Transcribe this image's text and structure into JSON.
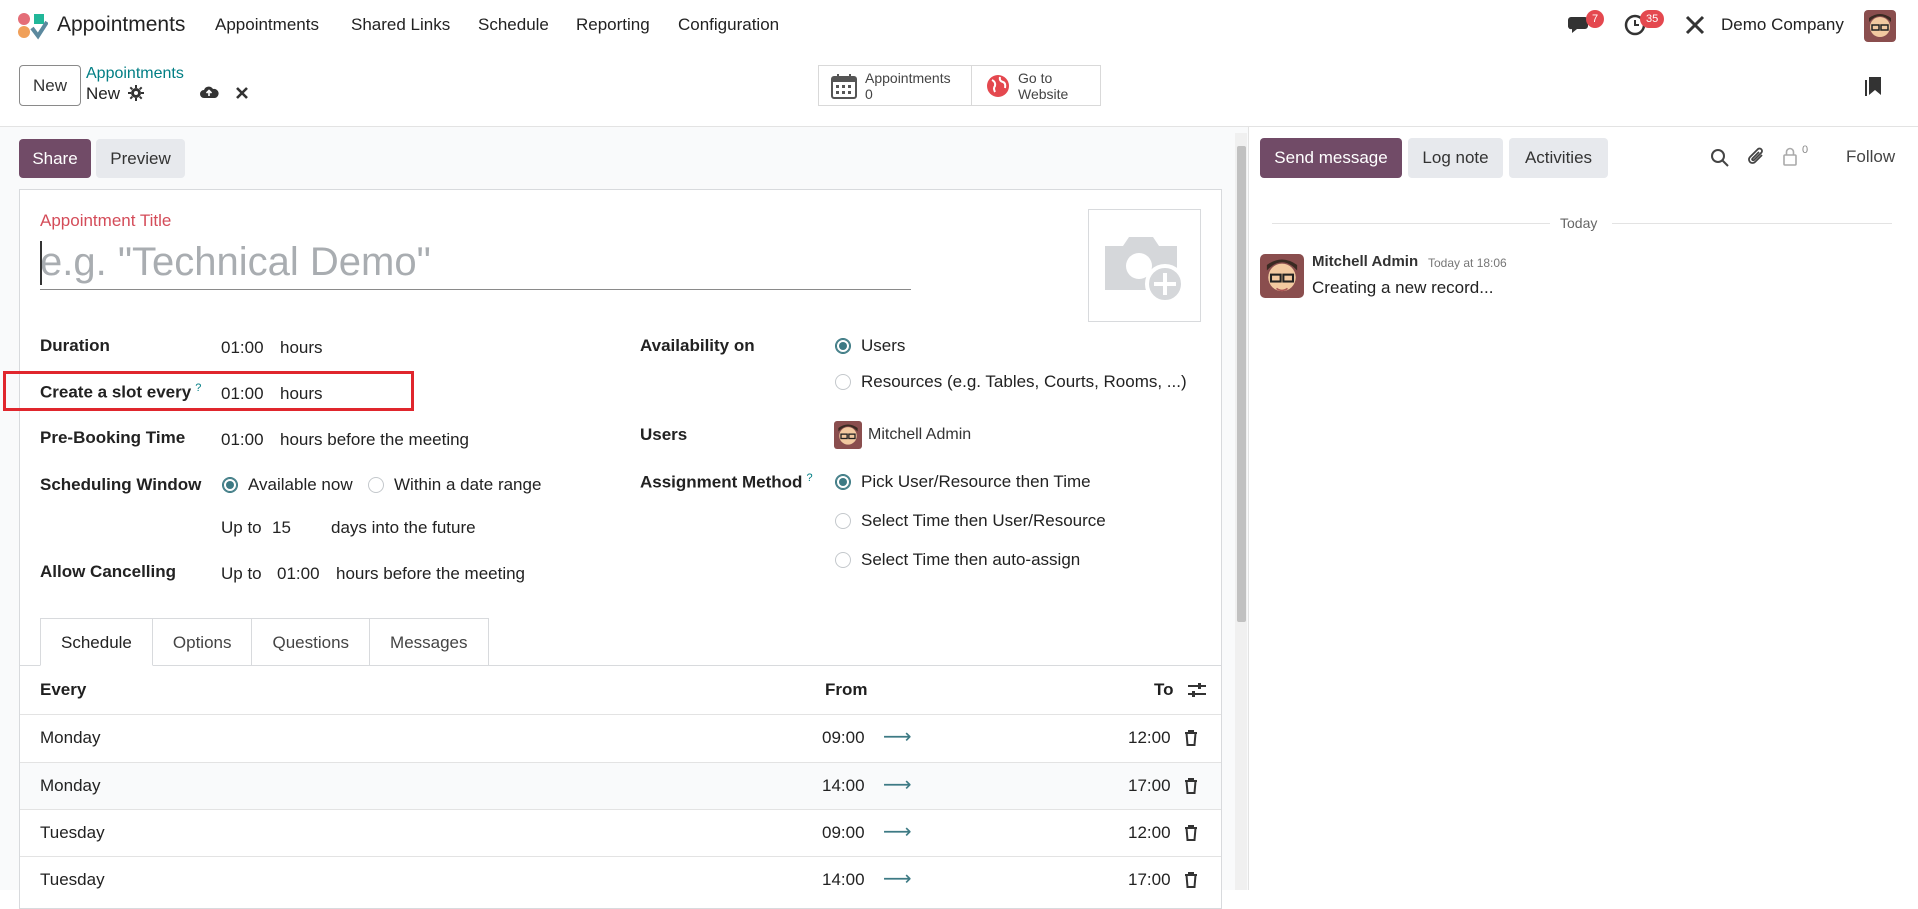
{
  "app": {
    "name": "Appointments",
    "menu": [
      "Appointments",
      "Shared Links",
      "Schedule",
      "Reporting",
      "Configuration"
    ],
    "messages_badge": "7",
    "activities_badge": "35",
    "company": "Demo Company"
  },
  "control": {
    "new_label": "New",
    "breadcrumb_parent": "Appointments",
    "breadcrumb_current": "New",
    "smart_appointments_label": "Appointments",
    "smart_appointments_count": "0",
    "smart_website_line1": "Go to",
    "smart_website_line2": "Website"
  },
  "form": {
    "share_label": "Share",
    "preview_label": "Preview",
    "title_label": "Appointment Title",
    "title_placeholder": "e.g. \"Technical Demo\"",
    "duration_label": "Duration",
    "duration_value": "01:00",
    "duration_unit": "hours",
    "slot_label": "Create a slot every",
    "slot_value": "01:00",
    "slot_unit": "hours",
    "prebooking_label": "Pre-Booking Time",
    "prebooking_value": "01:00",
    "prebooking_unit": "hours before the meeting",
    "window_label": "Scheduling Window",
    "window_option_now": "Available now",
    "window_option_range": "Within a date range",
    "upto_label": "Up to",
    "upto_value": "15",
    "upto_unit": "days into the future",
    "cancel_label": "Allow Cancelling",
    "cancel_upto": "Up to",
    "cancel_value": "01:00",
    "cancel_unit": "hours before the meeting",
    "availability_label": "Availability on",
    "availability_users": "Users",
    "availability_resources": "Resources (e.g. Tables, Courts, Rooms, ...)",
    "users_label": "Users",
    "users_value": "Mitchell Admin",
    "assignment_label": "Assignment Method",
    "assignment_opt1": "Pick User/Resource then Time",
    "assignment_opt2": "Select Time then User/Resource",
    "assignment_opt3": "Select Time then auto-assign",
    "help_mark": "?"
  },
  "tabs": [
    "Schedule",
    "Options",
    "Questions",
    "Messages"
  ],
  "schedule": {
    "headers": {
      "every": "Every",
      "from": "From",
      "to": "To"
    },
    "rows": [
      {
        "day": "Monday",
        "from": "09:00",
        "to": "12:00"
      },
      {
        "day": "Monday",
        "from": "14:00",
        "to": "17:00"
      },
      {
        "day": "Tuesday",
        "from": "09:00",
        "to": "12:00"
      },
      {
        "day": "Tuesday",
        "from": "14:00",
        "to": "17:00"
      }
    ]
  },
  "chatter": {
    "send_label": "Send message",
    "log_label": "Log note",
    "activities_label": "Activities",
    "followers_count": "0",
    "follow_label": "Follow",
    "today_label": "Today",
    "author": "Mitchell Admin",
    "time": "Today at 18:06",
    "body": "Creating a new record..."
  },
  "colors": {
    "brand": "#714b67",
    "teal": "#017e84",
    "required_label": "#d44c59",
    "highlight": "#e0262d",
    "badge": "#e4484f"
  }
}
